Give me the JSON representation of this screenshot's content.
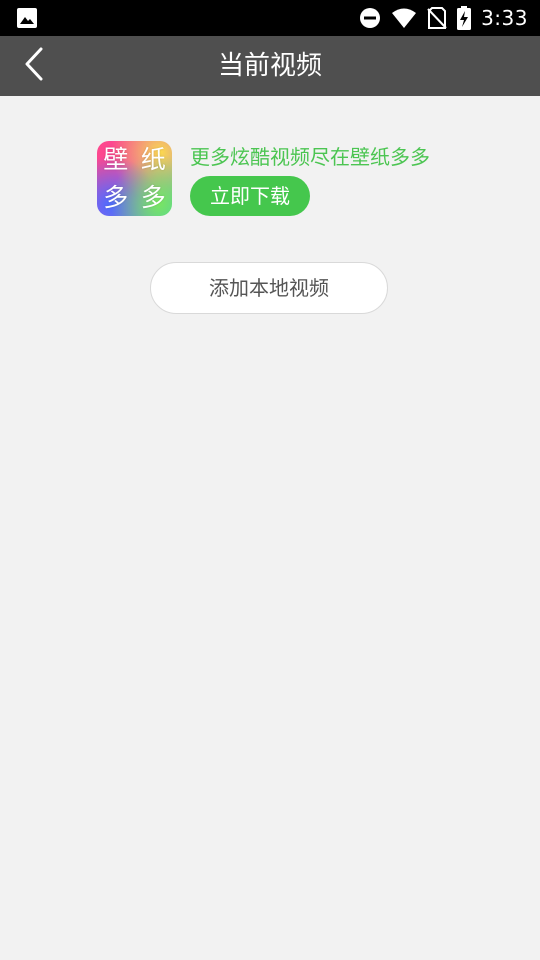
{
  "status_bar": {
    "time": "3:33",
    "left_icon": "image-notification-icon",
    "icons": [
      "do-not-disturb-icon",
      "wifi-icon",
      "no-sim-icon",
      "battery-charging-icon"
    ]
  },
  "header": {
    "title": "当前视频",
    "back_icon": "chevron-left-icon"
  },
  "promo": {
    "logo_chars": [
      "壁",
      "纸",
      "多",
      "多"
    ],
    "text": "更多炫酷视频尽在壁纸多多",
    "download_label": "立即下载"
  },
  "main": {
    "add_local_video_label": "添加本地视频"
  },
  "colors": {
    "status_bar_bg": "#000000",
    "title_bar_bg": "#4f4f4f",
    "page_bg": "#f2f2f2",
    "accent_green": "#45c74d",
    "promo_text_green": "#4cc552"
  }
}
